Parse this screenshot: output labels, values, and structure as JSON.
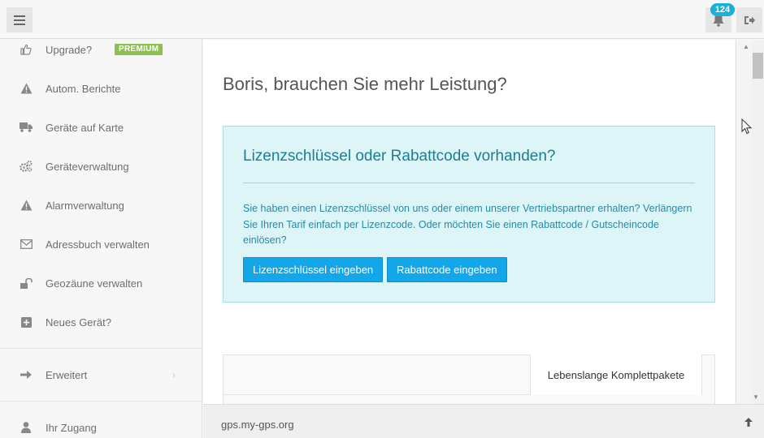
{
  "topbar": {
    "notification_count": "124"
  },
  "sidebar": {
    "items": [
      {
        "label": "Upgrade?",
        "badge": "PREMIUM",
        "icon": "thumbs-up-icon"
      },
      {
        "label": "Autom. Berichte",
        "icon": "warning-icon"
      },
      {
        "label": "Geräte auf Karte",
        "icon": "truck-icon"
      },
      {
        "label": "Geräteverwaltung",
        "icon": "gears-icon"
      },
      {
        "label": "Alarmverwaltung",
        "icon": "warning-icon"
      },
      {
        "label": "Adressbuch verwalten",
        "icon": "envelope-icon"
      },
      {
        "label": "Geozäune verwalten",
        "icon": "unlock-icon"
      },
      {
        "label": "Neues Gerät?",
        "icon": "plus-square-icon"
      },
      {
        "label": "Erweitert",
        "icon": "arrow-right-icon"
      },
      {
        "label": "Ihr Zugang",
        "icon": "user-icon"
      }
    ]
  },
  "main": {
    "title": "Boris, brauchen Sie mehr Leistung?",
    "info": {
      "title": "Lizenzschlüssel oder Rabattcode vorhanden?",
      "text": "Sie haben einen Lizenzschlüssel von uns oder einem unserer Vertriebspartner erhalten? Verlängern Sie Ihren Tarif einfach per Lizenzcode. Oder möchten Sie einen Rabattcode / Gutscheincode einlösen?",
      "license_button": "Lizenzschlüssel eingeben",
      "discount_button": "Rabattcode eingeben"
    },
    "tabs": {
      "active_label": "Lebenslange Komplettpakete"
    }
  },
  "footer": {
    "domain": "gps.my-gps.org"
  },
  "colors": {
    "accent": "#13a6e8",
    "badge": "#1ab0d8",
    "premium": "#8cc152",
    "info_bg": "#def5f8",
    "info_text": "#2789a3"
  }
}
